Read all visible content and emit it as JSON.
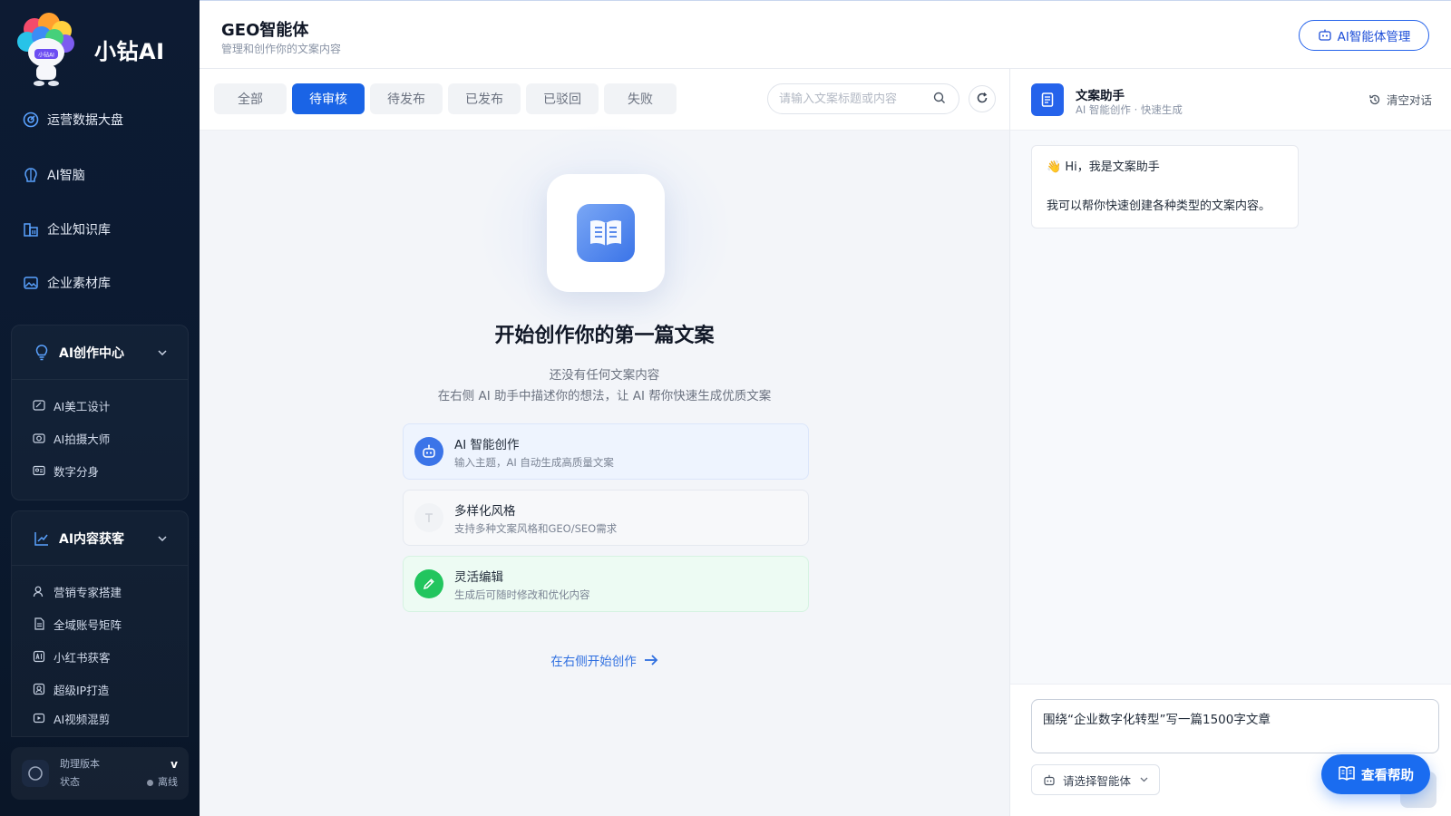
{
  "brand": {
    "name": "小钻AI",
    "logo_text": "小钻AI"
  },
  "sidebar": {
    "nav": [
      {
        "label": "运营数据大盘",
        "icon": "dashboard-icon"
      },
      {
        "label": "AI智脑",
        "icon": "brain-icon"
      },
      {
        "label": "企业知识库",
        "icon": "knowledge-base-icon"
      },
      {
        "label": "企业素材库",
        "icon": "image-library-icon"
      }
    ],
    "groups": [
      {
        "label": "AI创作中心",
        "icon": "lightbulb-icon",
        "items": [
          {
            "label": "AI美工设计",
            "icon": "design-icon"
          },
          {
            "label": "AI拍摄大师",
            "icon": "camera-icon"
          },
          {
            "label": "数字分身",
            "icon": "id-card-icon"
          }
        ]
      },
      {
        "label": "AI内容获客",
        "icon": "trend-chart-icon",
        "items": [
          {
            "label": "营销专家搭建",
            "icon": "user-expert-icon"
          },
          {
            "label": "全域账号矩阵",
            "icon": "document-icon"
          },
          {
            "label": "小红书获客",
            "icon": "ai-badge-icon"
          },
          {
            "label": "超级IP打造",
            "icon": "ip-icon"
          },
          {
            "label": "AI视频混剪",
            "icon": "video-icon"
          }
        ]
      }
    ],
    "version": {
      "label": "助理版本",
      "status_label": "状态",
      "version_value": "v",
      "status_value": "离线"
    }
  },
  "header": {
    "title": "GEO智能体",
    "subtitle": "管理和创作你的文案内容",
    "manage_button": "AI智能体管理"
  },
  "main": {
    "tabs": [
      {
        "label": "全部",
        "active": false
      },
      {
        "label": "待审核",
        "active": true
      },
      {
        "label": "待发布",
        "active": false
      },
      {
        "label": "已发布",
        "active": false
      },
      {
        "label": "已驳回",
        "active": false
      },
      {
        "label": "失败",
        "active": false
      }
    ],
    "search_placeholder": "请输入文案标题或内容",
    "empty": {
      "title": "开始创作你的第一篇文案",
      "desc1": "还没有任何文案内容",
      "desc2": "在右侧 AI 助手中描述你的想法，让 AI 帮你快速生成优质文案"
    },
    "features": [
      {
        "title": "AI 智能创作",
        "desc": "输入主题，AI 自动生成高质量文案",
        "icon": "robot-icon",
        "color": "#3b74e8"
      },
      {
        "title": "多样化风格",
        "desc": "支持多种文案风格和GEO/SEO需求",
        "icon": "text-style-icon",
        "color": "#e5e7eb"
      },
      {
        "title": "灵活编辑",
        "desc": "生成后可随时修改和优化内容",
        "icon": "pencil-icon",
        "color": "#22c55e"
      }
    ],
    "start_link": "在右侧开始创作"
  },
  "assistant": {
    "name": "文案助手",
    "subtitle": "AI 智能创作 · 快速生成",
    "clear_label": "清空对话",
    "greeting": "👋 Hi，我是文案助手",
    "intro": "我可以帮你快速创建各种类型的文案内容。",
    "input_value": "围绕“企业数字化转型”写一篇1500字文章",
    "agent_select": "请选择智能体",
    "help_button": "查看帮助"
  },
  "colors": {
    "primary": "#1a64e6",
    "sidebar_bg": "#0d1b33",
    "success": "#22c55e"
  }
}
